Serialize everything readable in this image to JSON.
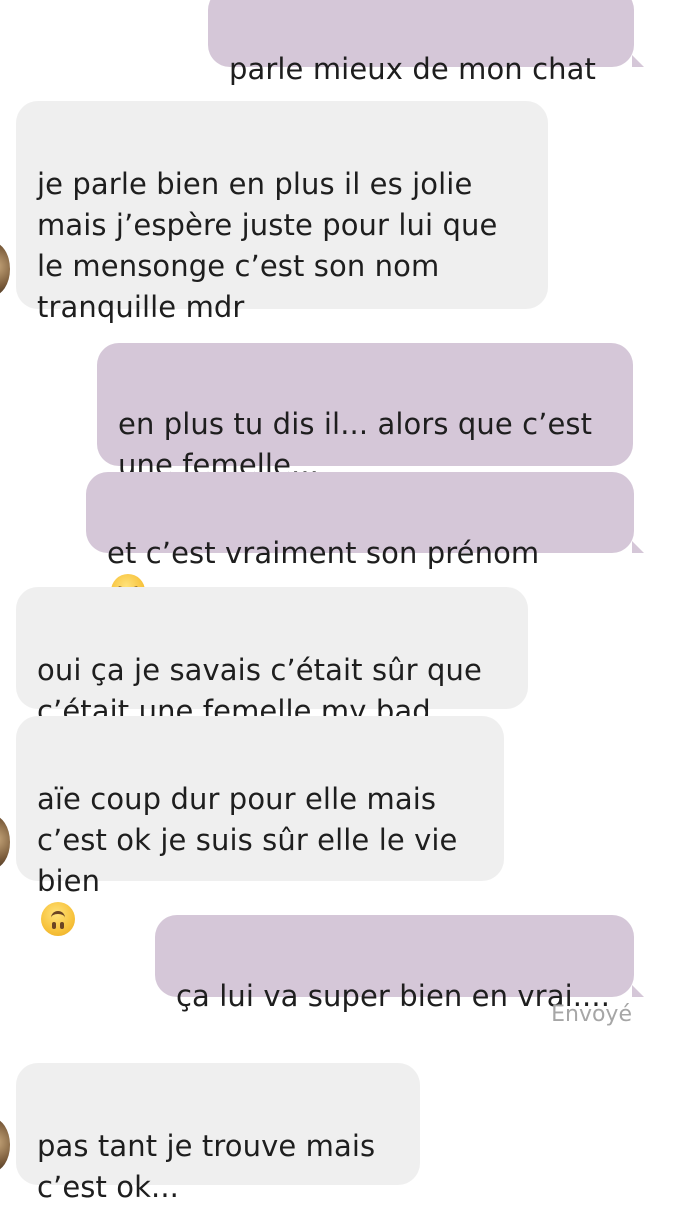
{
  "messages": [
    {
      "side": "sent",
      "text": "parle mieux de mon chat"
    },
    {
      "side": "received",
      "text": "je parle bien en plus il es jolie\nmais j’espère juste pour lui que\nle mensonge c’est son nom\ntranquille mdr"
    },
    {
      "side": "sent",
      "text": "en plus tu dis il... alors que c’est\nune femelle..."
    },
    {
      "side": "sent",
      "text": "et c’est vraiment son prénom",
      "emoji": "pensive-face"
    },
    {
      "side": "received",
      "text": "oui ça je savais c’était sûr que\nc’était une femelle my bad"
    },
    {
      "side": "received",
      "text": "aïe coup dur pour elle mais\nc’est ok je suis sûr elle le vie\nbien",
      "emoji": "upside-down-face"
    },
    {
      "side": "sent",
      "text": "ça lui va super bien en vrai...."
    },
    {
      "side": "received",
      "text": "pas tant je trouve mais\nc’est ok..."
    }
  ],
  "status": "Envoyé",
  "colors": {
    "sent_bubble": "#d5c7d8",
    "received_bubble": "#efefef",
    "status_text": "#a6a6a6"
  }
}
